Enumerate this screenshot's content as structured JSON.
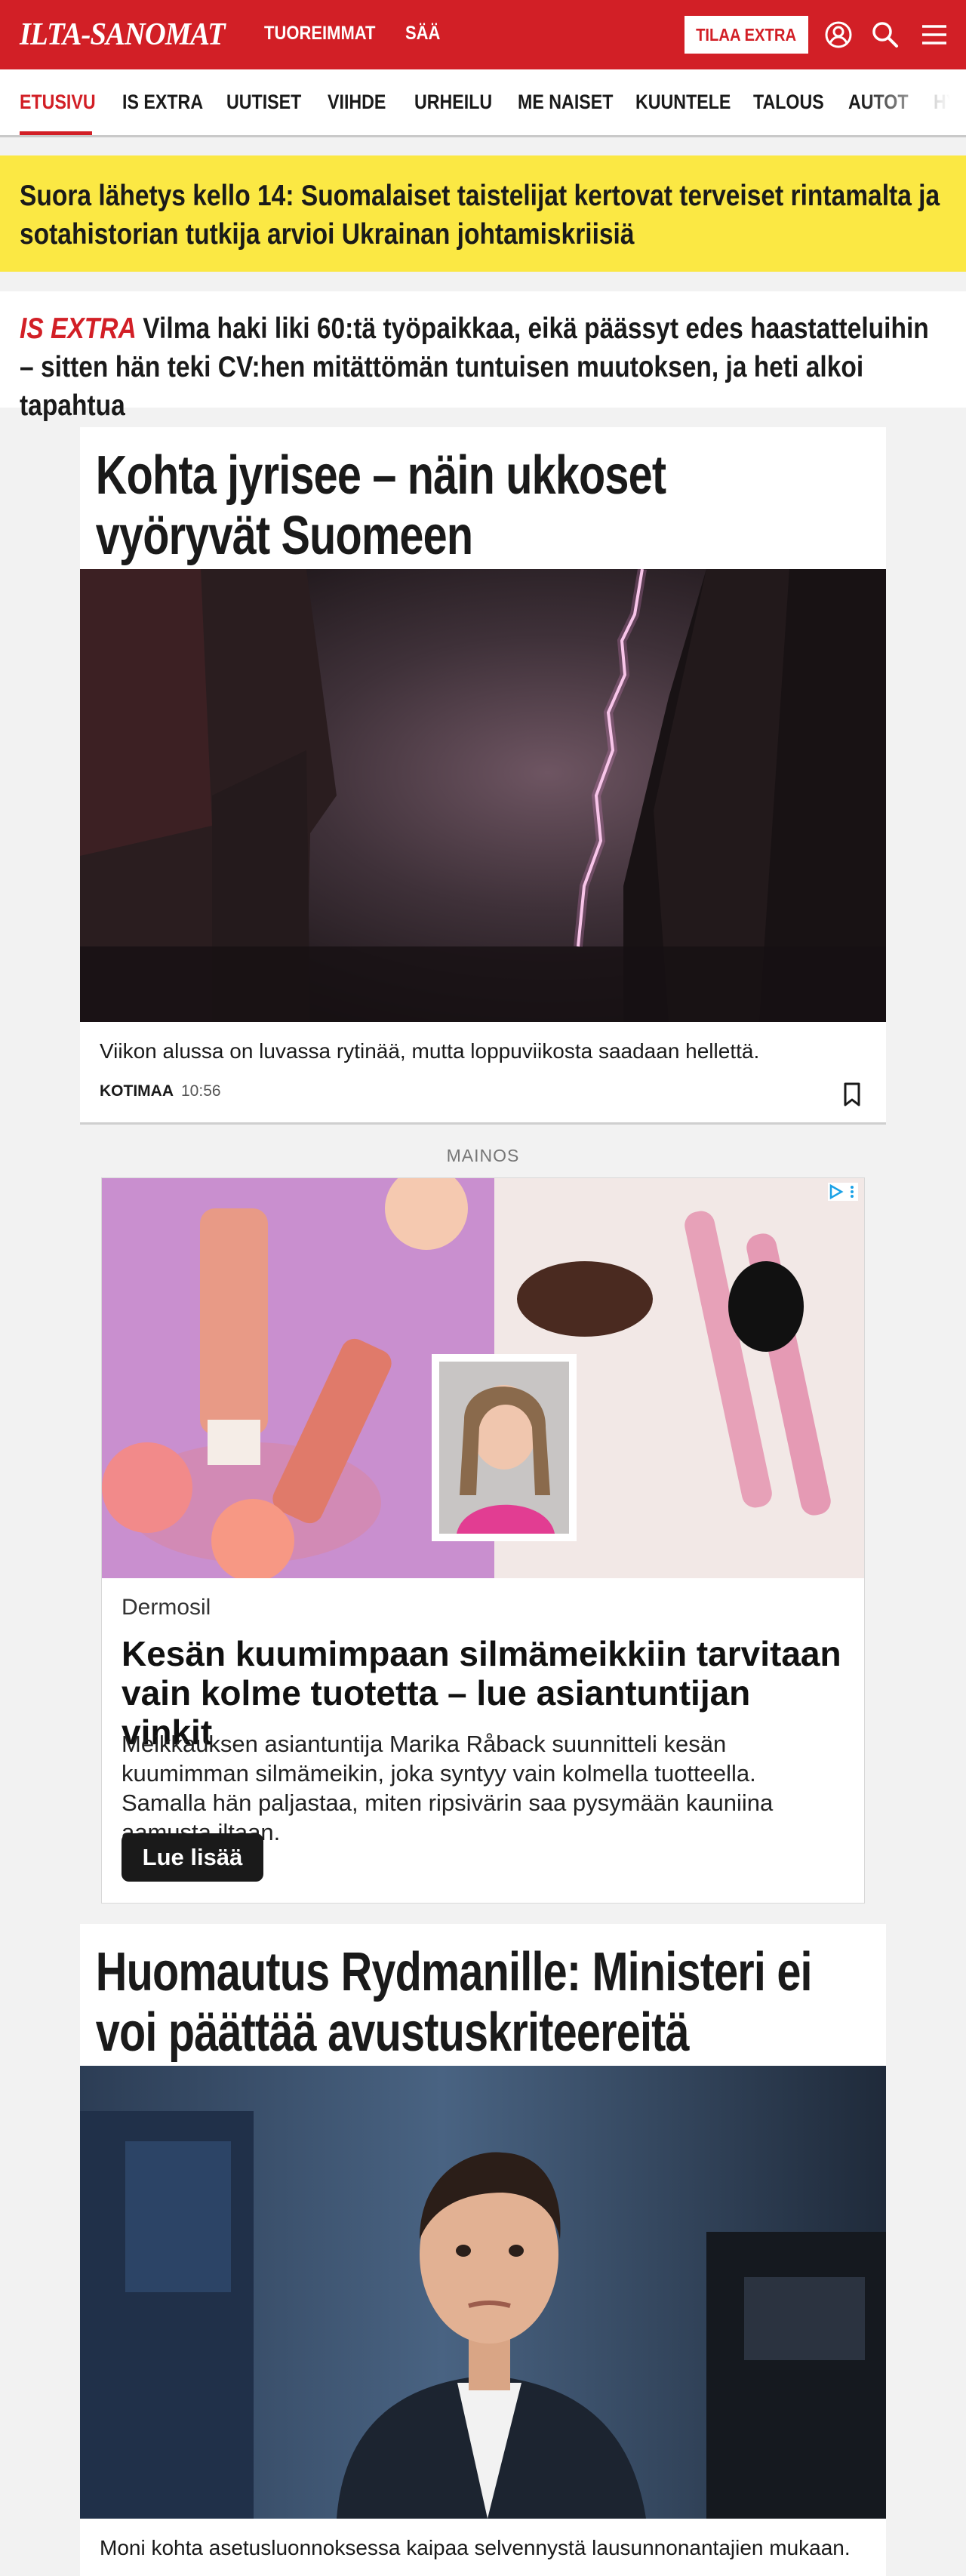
{
  "header": {
    "logo": "ILTA-SANOMAT",
    "nav": [
      "TUOREIMMAT",
      "SÄÄ"
    ],
    "subscribe_label": "TILAA EXTRA",
    "icons": [
      "user-icon",
      "search-icon",
      "menu-icon"
    ],
    "brand_color": "#d21f26"
  },
  "sections": {
    "items": [
      "ETUSIVU",
      "IS EXTRA",
      "UUTISET",
      "VIIHDE",
      "URHEILU",
      "ME NAISET",
      "KUUNTELE",
      "TALOUS",
      "AUTOT",
      "HY"
    ],
    "active": "ETUSIVU"
  },
  "live_banner": {
    "text": "Suora lähetys kello 14: Suomalaiset taistelijat kertovat terveiset rintamalta ja sotahistorian tutkija arvioi Ukrainan johtamiskriisiä",
    "background": "#fbe844"
  },
  "extra_teaser": {
    "kicker": "IS EXTRA",
    "text": "Vilma haki liki 60:tä työpaikkaa, eikä päässyt edes haastatteluihin – sitten hän teki CV:hen mitättömän tuntuisen muutoksen, ja heti alkoi tapahtua"
  },
  "articles": [
    {
      "headline": "Kohta jyrisee – näin ukkoset vyöryvät Suomeen",
      "image": "lightning-photo",
      "lead": "Viikon alussa on luvassa rytinää, mutta loppuviikosta saadaan hellettä.",
      "category": "KOTIMAA",
      "time": "10:56"
    },
    {
      "headline": "Huomautus Rydmanille: Ministeri ei voi päättää avustuskriteereitä",
      "image": "minister-portrait",
      "lead": "Moni kohta asetusluonnoksessa kaipaa selvennystä lausunnonantajien mukaan."
    }
  ],
  "ad": {
    "label": "MAINOS",
    "brand": "Dermosil",
    "title": "Kesän kuumimpaan silmämeikkiin tarvitaan vain kolme tuotetta – lue asiantuntijan vinkit",
    "body": "Meikkauksen asiantuntija Marika Råback suunnitteli kesän kuumimman silmämeikin, joka syntyy vain kolmella tuotteella. Samalla hän paljastaa, miten ripsivärin saa pysymään kauniina aamusta iltaan.",
    "cta": "Lue lisää"
  }
}
